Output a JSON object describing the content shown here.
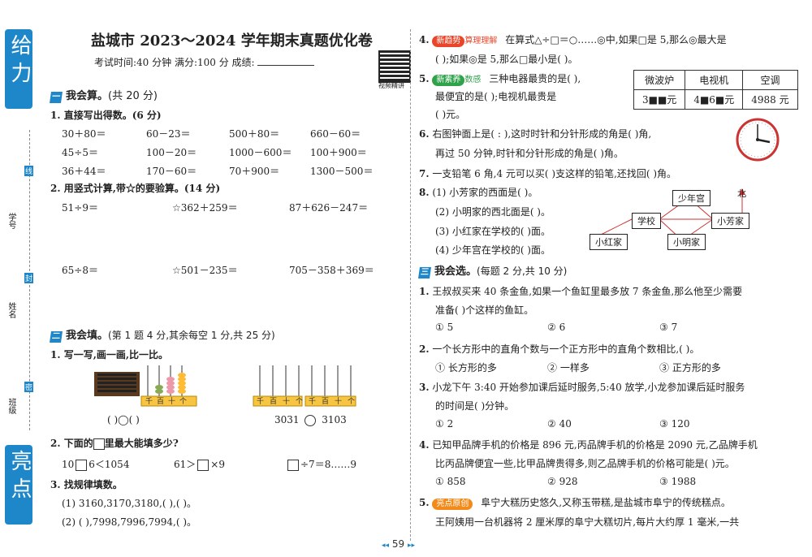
{
  "sidebar": {
    "top_label": "给 力",
    "bottom_label": "亮 点",
    "fields": [
      "学号",
      "姓名",
      "班级"
    ],
    "cut_marks": [
      "线",
      "封",
      "密"
    ]
  },
  "header": {
    "title": "盐城市 2023～2024 学年期末真题优化卷",
    "exam_info": "考试时间:40 分钟    满分:100 分    成绩:",
    "qr_caption": "视频精讲"
  },
  "left": {
    "sec1": {
      "num": "一",
      "title": "我会算。",
      "desc": "(共 20 分)"
    },
    "q1": {
      "label": "1. 直接写出得数。(6 分)",
      "rows": [
        [
          "30＋80＝",
          "60－23＝",
          "500＋80＝",
          "660－60＝"
        ],
        [
          "45÷5＝",
          "100－20＝",
          "1000－600＝",
          "100＋900＝"
        ],
        [
          "36＋44＝",
          "170－60＝",
          "70＋900＝",
          "1300－500＝"
        ]
      ]
    },
    "q2": {
      "label": "2. 用竖式计算,带☆的要验算。(14 分)",
      "row1": [
        "51÷9＝",
        "☆362＋259＝",
        "87＋626－247＝"
      ],
      "row2": [
        "65÷8＝",
        "☆501－235＝",
        "705－358＋369＝"
      ]
    },
    "sec2": {
      "num": "二",
      "title": "我会填。",
      "desc": "(第 1 题 4 分,其余每空 1 分,共 25 分)"
    },
    "q3": {
      "label": "1. 写一写,画一画,比一比。",
      "abacus_labels": [
        "千",
        "百",
        "十",
        "个"
      ],
      "compare_left": "(    )◯(    )",
      "compare_right_a": "3031",
      "compare_right_b": "3103"
    },
    "q4": {
      "label": "2. 下面的",
      "label2": "里最大能填多少?",
      "e1a": "10",
      "e1b": "6＜1054",
      "e2a": "61＞",
      "e2b": "×9",
      "e3": "÷7＝8……9"
    },
    "q5": {
      "label": "3. 找规律填数。",
      "l1": "(1) 3160,3170,3180,(      ),(      )。",
      "l2": "(2) (      ),7998,7996,7994,(      )。"
    }
  },
  "right": {
    "q4": {
      "num": "4.",
      "tag": "新趋势",
      "sub": "算理理解",
      "l1": "在算式△÷□＝○……◎中,如果□是 5,那么◎最大是",
      "l2": "(      );如果◎是 5,那么□最小是(      )。"
    },
    "q5": {
      "num": "5.",
      "tag": "新素养",
      "sub": "数感",
      "l1": "三种电器最贵的是(      ),",
      "l2": "最便宜的是(      );电视机最贵是",
      "l3": "(      )元。",
      "table_head": [
        "微波炉",
        "电视机",
        "空调"
      ],
      "table_vals": [
        "3■■元",
        "4■6■元",
        "4988 元"
      ]
    },
    "q6": {
      "num": "6.",
      "l1": "右图钟面上是(    :    ),这时时针和分针形成的角是(      )角,",
      "l2": "再过 50 分钟,时针和分针形成的角是(      )角。"
    },
    "q7": {
      "num": "7.",
      "l1": "一支铅笔 6 角,4 元可以买(      )支这样的铅笔,还找回(      )角。"
    },
    "q8": {
      "num": "8.",
      "l1": "(1) 小芳家的西面是(      )。",
      "l2": "(2) 小明家的西北面是(      )。",
      "l3": "(3) 小红家在学校的(      )面。",
      "l4": "(4) 少年宫在学校的(      )面。",
      "map": {
        "north": "北",
        "palace": "少年宫",
        "school": "学校",
        "fang": "小芳家",
        "hong": "小红家",
        "ming": "小明家"
      }
    },
    "sec3": {
      "num": "三",
      "title": "我会选。",
      "desc": "(每题 2 分,共 10 分)"
    },
    "c1": {
      "num": "1.",
      "l1": "王叔叔买来 40 条金鱼,如果一个鱼缸里最多放 7 条金鱼,那么他至少需要",
      "l2": "准备(      )个这样的鱼缸。",
      "opts": [
        "① 5",
        "② 6",
        "③ 7"
      ]
    },
    "c2": {
      "num": "2.",
      "l1": "一个长方形中的直角个数与一个正方形中的直角个数相比,(      )。",
      "opts": [
        "① 长方形的多",
        "② 一样多",
        "③ 正方形的多"
      ]
    },
    "c3": {
      "num": "3.",
      "l1": "小龙下午 3:40 开始参加课后延时服务,5:40 放学,小龙参加课后延时服务",
      "l2": "的时间是(      )分钟。",
      "opts": [
        "① 2",
        "② 40",
        "③ 120"
      ]
    },
    "c4": {
      "num": "4.",
      "l1": "已知甲品牌手机的价格是 896 元,丙品牌手机的价格是 2090 元,乙品牌手机",
      "l2": "比丙品牌便宜一些,比甲品牌贵得多,则乙品牌手机的价格可能是(      )元。",
      "opts": [
        "① 858",
        "② 928",
        "③ 1988"
      ]
    },
    "c5": {
      "num": "5.",
      "tag": "亮点原创",
      "l1": "阜宁大糕历史悠久,又称玉带糕,是盐城市阜宁的传统糕点。",
      "l2": "王阿姨用一台机器将 2 厘米厚的阜宁大糕切片,每片大约厚 1 毫米,一共"
    }
  },
  "footer": {
    "page": "59"
  }
}
